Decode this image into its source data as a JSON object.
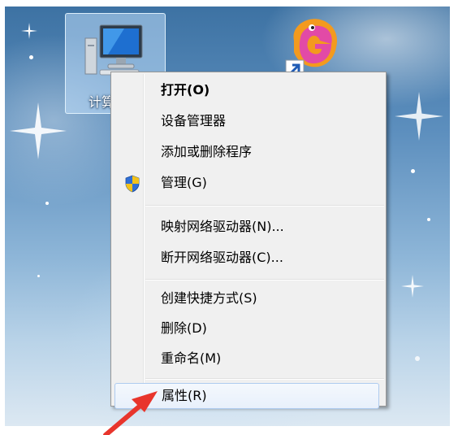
{
  "desktop": {
    "computer_icon_label": "计算机"
  },
  "context_menu": {
    "items": [
      {
        "label": "打开(O)",
        "bold": true
      },
      {
        "label": "设备管理器"
      },
      {
        "label": "添加或删除程序"
      },
      {
        "label": "管理(G)",
        "icon": "uac-shield-icon"
      },
      {
        "label": "映射网络驱动器(N)..."
      },
      {
        "label": "断开网络驱动器(C)..."
      },
      {
        "label": "创建快捷方式(S)"
      },
      {
        "label": "删除(D)"
      },
      {
        "label": "重命名(M)"
      },
      {
        "label": "属性(R)",
        "highlighted": true
      }
    ]
  },
  "colors": {
    "menu_background": "#f0f0f0",
    "highlight_border": "#aecbef",
    "annotation_arrow": "#e8352c",
    "shield_blue": "#2f6fd6",
    "shield_yellow": "#f3c21a"
  }
}
